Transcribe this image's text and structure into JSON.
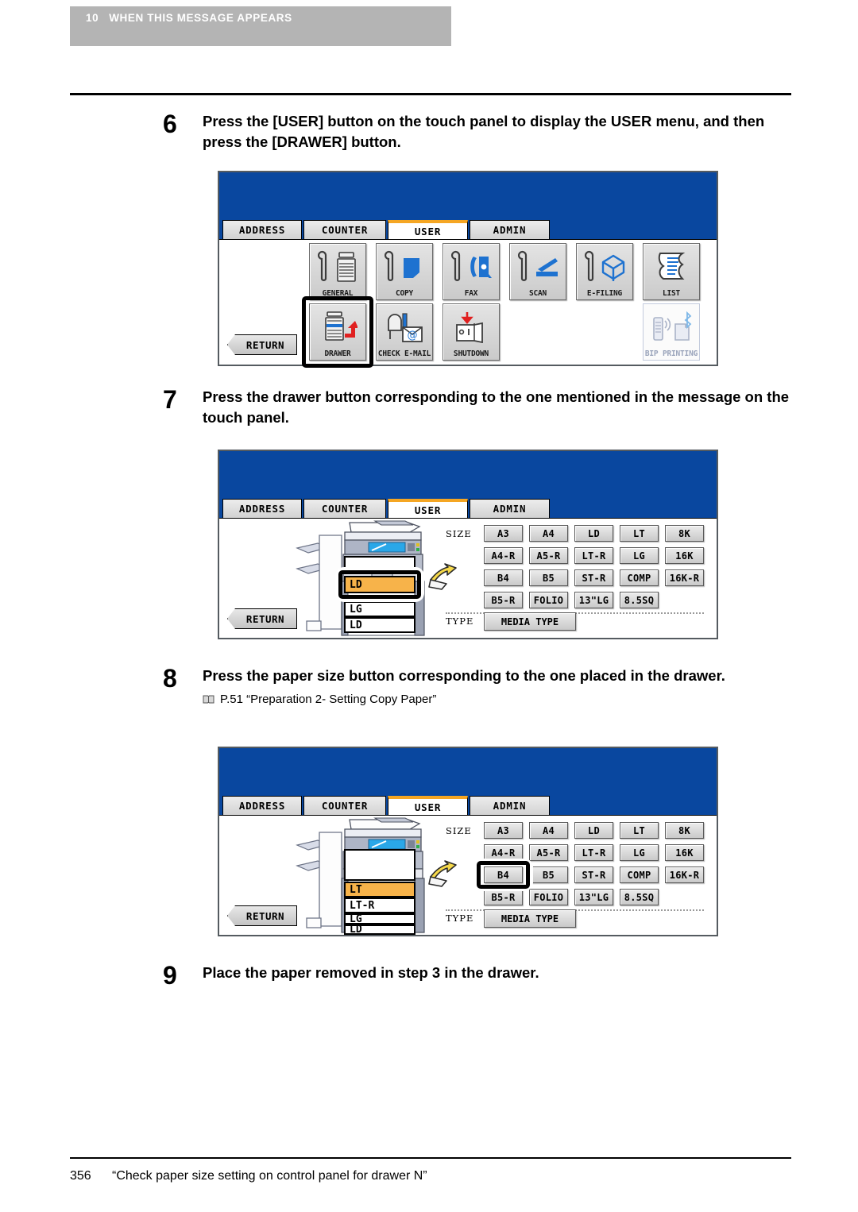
{
  "running_head": {
    "chapter_number": "10",
    "chapter_title": "WHEN THIS MESSAGE APPEARS"
  },
  "footer": {
    "page_number": "356",
    "text": "“Check paper size setting on control panel for drawer N”"
  },
  "steps": [
    {
      "number": "6",
      "text": "Press the [USER] button on the touch panel to display the USER menu, and then press the [DRAWER] button."
    },
    {
      "number": "7",
      "text": "Press the drawer button corresponding to the one mentioned in the message on the touch panel."
    },
    {
      "number": "8",
      "text": "Press the paper size button corresponding to the one placed in the drawer.",
      "reference": "P.51 “Preparation 2- Setting Copy Paper”",
      "reference_icon": "book-icon"
    },
    {
      "number": "9",
      "text": "Place the paper removed in step 3 in the drawer."
    }
  ],
  "tabs": [
    {
      "label": "ADDRESS",
      "active": false
    },
    {
      "label": "COUNTER",
      "active": false
    },
    {
      "label": "USER",
      "active": true
    },
    {
      "label": "ADMIN",
      "active": false
    }
  ],
  "colors": {
    "panel_header_blue": "#09479F",
    "active_tab_accent": "#F5A623",
    "selected_drawer_orange": "#F7B34A",
    "banner_gray": "#B4B4B4",
    "icon_blue": "#1E72D0",
    "icon_red": "#E02020"
  },
  "panel_user_menu": {
    "return_label": "RETURN",
    "buttons_row1": [
      {
        "label": "GENERAL",
        "icon": "wrench-copier-icon",
        "enabled": true
      },
      {
        "label": "COPY",
        "icon": "wrench-copy-icon",
        "enabled": true
      },
      {
        "label": "FAX",
        "icon": "wrench-fax-icon",
        "enabled": true
      },
      {
        "label": "SCAN",
        "icon": "wrench-scan-icon",
        "enabled": true
      },
      {
        "label": "E-FILING",
        "icon": "wrench-efiling-icon",
        "enabled": true
      },
      {
        "label": "LIST",
        "icon": "list-page-icon",
        "enabled": true
      }
    ],
    "buttons_row2": [
      {
        "label": "DRAWER",
        "icon": "drawer-icon",
        "enabled": true,
        "highlighted": true
      },
      {
        "label": "CHECK E-MAIL",
        "icon": "mailbox-icon",
        "enabled": true,
        "highlighted": false
      },
      {
        "label": "SHUTDOWN",
        "icon": "shutdown-icon",
        "enabled": true,
        "highlighted": false
      },
      {
        "label": "BIP PRINTING",
        "icon": "bip-printing-icon",
        "enabled": false,
        "highlighted": false
      }
    ]
  },
  "panel_drawer_select": {
    "return_label": "RETURN",
    "size_label": "SIZE",
    "type_label": "TYPE",
    "media_type_label": "MEDIA TYPE",
    "drawer_rows": [
      {
        "label": "LD",
        "selected": true,
        "highlighted": true
      },
      {
        "label": "LG",
        "selected": false,
        "highlighted": false
      },
      {
        "label": "LD",
        "selected": false,
        "highlighted": false
      }
    ],
    "size_rows": [
      [
        "A3",
        "A4",
        "LD",
        "LT",
        "8K"
      ],
      [
        "A4-R",
        "A5-R",
        "LT-R",
        "LG",
        "16K"
      ],
      [
        "B4",
        "B5",
        "ST-R",
        "COMP",
        "16K-R"
      ],
      [
        "B5-R",
        "FOLIO",
        "13\"LG",
        "8.5SQ"
      ]
    ],
    "highlighted_size": null
  },
  "panel_size_select": {
    "return_label": "RETURN",
    "size_label": "SIZE",
    "type_label": "TYPE",
    "media_type_label": "MEDIA TYPE",
    "drawer_rows": [
      {
        "label": "LT",
        "selected": true,
        "highlighted": false
      },
      {
        "label": "LT-R",
        "selected": false,
        "highlighted": false
      },
      {
        "label": "LG",
        "selected": false,
        "highlighted": false
      },
      {
        "label": "LD",
        "selected": false,
        "highlighted": false
      }
    ],
    "size_rows": [
      [
        "A3",
        "A4",
        "LD",
        "LT",
        "8K"
      ],
      [
        "A4-R",
        "A5-R",
        "LT-R",
        "LG",
        "16K"
      ],
      [
        "B4",
        "B5",
        "ST-R",
        "COMP",
        "16K-R"
      ],
      [
        "B5-R",
        "FOLIO",
        "13\"LG",
        "8.5SQ"
      ]
    ],
    "highlighted_size": "B4"
  }
}
